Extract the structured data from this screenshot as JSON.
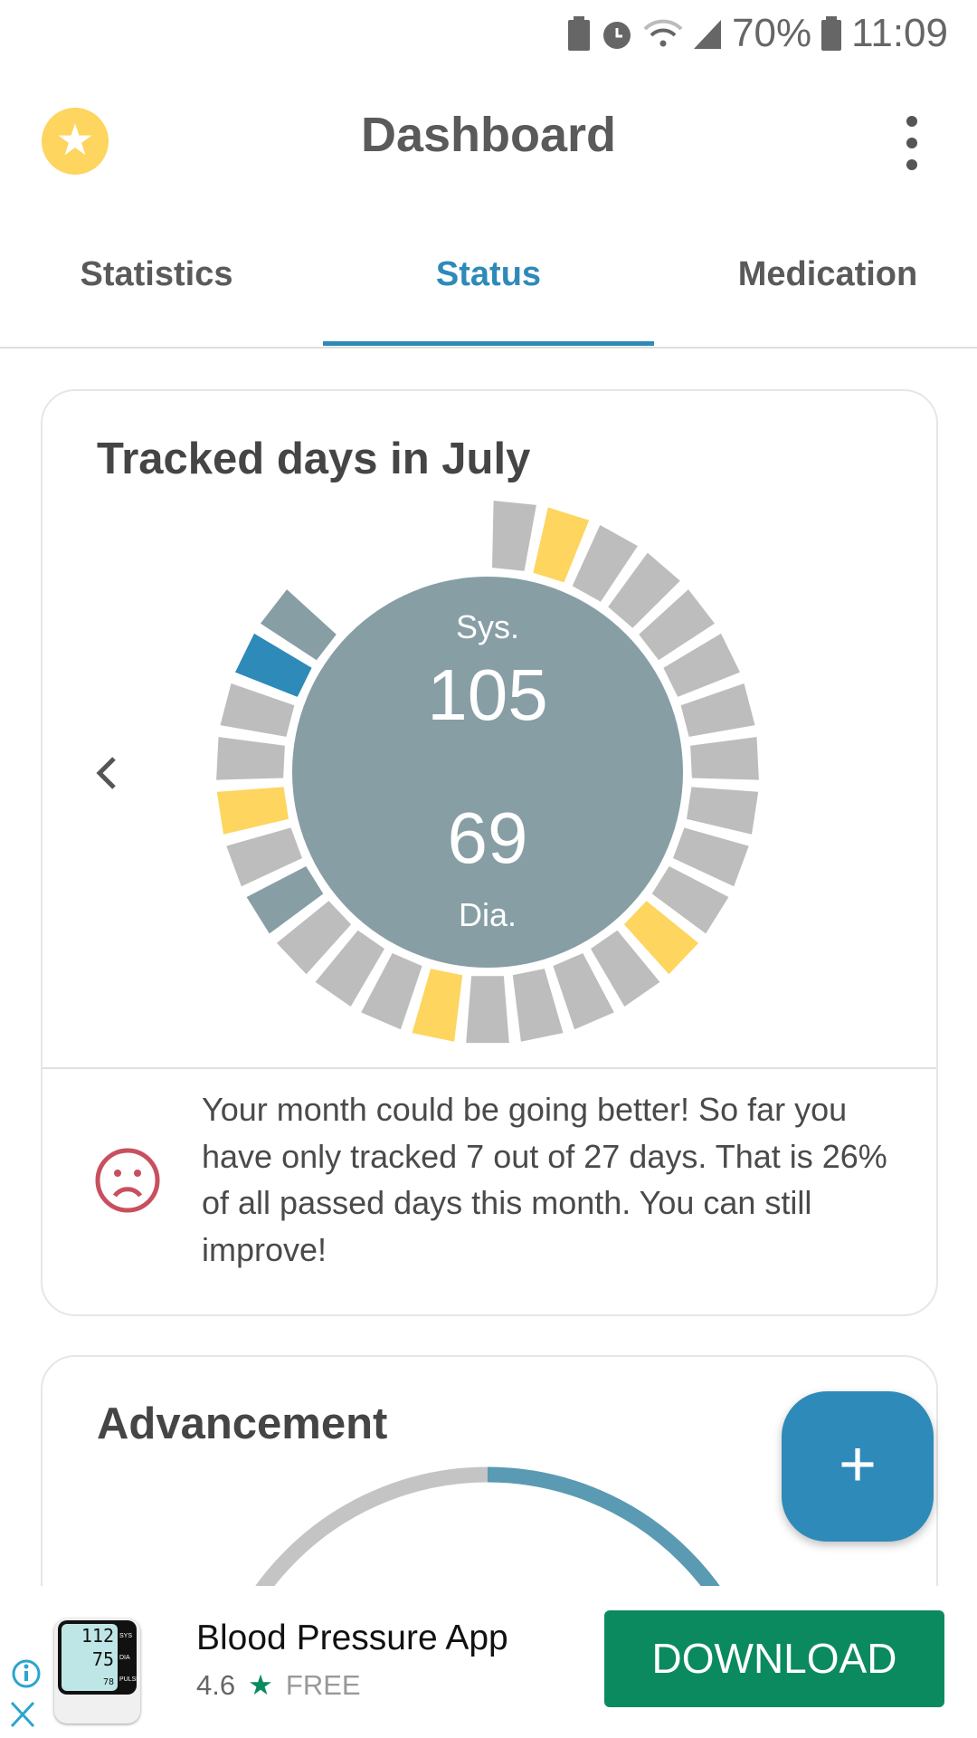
{
  "status_bar": {
    "battery_percent": "70%",
    "time": "11:09",
    "icons": [
      "battery-saver-icon",
      "alarm-icon",
      "wifi-icon",
      "signal-icon",
      "battery-icon"
    ]
  },
  "header": {
    "title": "Dashboard",
    "left_icon": "star-icon",
    "right_icon": "more-vert-icon"
  },
  "tabs": [
    {
      "label": "Statistics"
    },
    {
      "label": "Status",
      "active": true
    },
    {
      "label": "Medication"
    }
  ],
  "tracked_card": {
    "title": "Tracked days in July",
    "sys_label": "Sys.",
    "sys_value": "105",
    "dia_label": "Dia.",
    "dia_value": "69",
    "days_in_month": 31,
    "days": [
      "none",
      "yellow",
      "none",
      "none",
      "none",
      "none",
      "none",
      "none",
      "none",
      "none",
      "none",
      "yellow",
      "none",
      "none",
      "none",
      "none",
      "yellow",
      "none",
      "none",
      "none",
      "slate",
      "none",
      "yellow",
      "none",
      "none",
      "blue",
      "slate"
    ],
    "colors": {
      "none": "#bdbdbd",
      "yellow": "#fdd55f",
      "blue": "#2e8ab8",
      "slate": "#879ea5",
      "center": "#879ea5"
    },
    "message": "Your month could be going better! So far you have only tracked 7 out of 27 days. That is 26% of all passed days this month. You can still improve!",
    "mood_icon": "sad-face-icon",
    "mood_color": "#c8505e"
  },
  "advancement_card": {
    "title": "Advancement",
    "progress_percent": 50,
    "colors": {
      "track": "#c4c4c4",
      "fill": "#5b9ab3"
    }
  },
  "fab": {
    "label": "+"
  },
  "ad": {
    "app_name": "Blood Pressure App",
    "rating": "4.6",
    "price": "FREE",
    "button": "DOWNLOAD",
    "icon_sys": "112",
    "icon_dia": "75",
    "icon_pulse": "78",
    "icon_label_sys": "SYS",
    "icon_label_dia": "DIA",
    "icon_label_pulse": "PULSE",
    "button_color": "#0b8a5f"
  }
}
